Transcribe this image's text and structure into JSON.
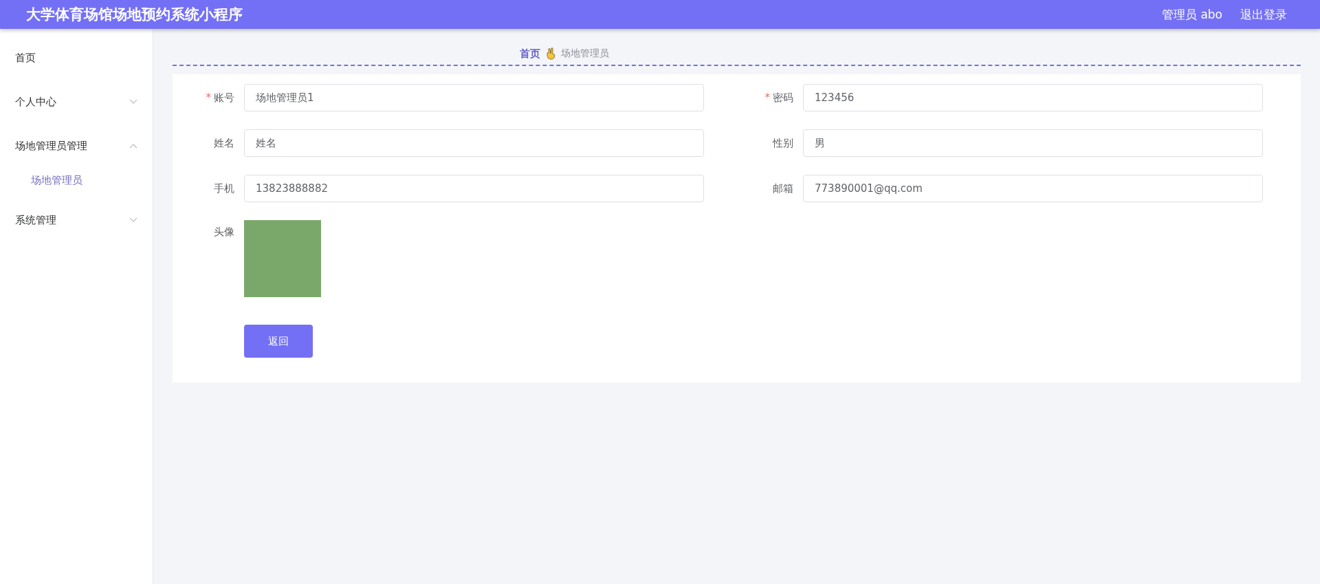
{
  "header": {
    "title": "大学体育场馆场地预约系统小程序",
    "user": "管理员 abo",
    "logout": "退出登录"
  },
  "sidebar": {
    "items": [
      {
        "label": "首页"
      },
      {
        "label": "个人中心",
        "expanded": false
      },
      {
        "label": "场地管理员管理",
        "expanded": true,
        "children": [
          {
            "label": "场地管理员",
            "selected": true
          }
        ]
      },
      {
        "label": "系统管理",
        "expanded": false
      }
    ]
  },
  "breadcrumb": {
    "home": "首页",
    "current": "场地管理员"
  },
  "form": {
    "fields": [
      {
        "label": "账号",
        "required_mark": "*",
        "value": "场地管理员1"
      },
      {
        "label": "密码",
        "required_mark": "*",
        "value": "123456"
      },
      {
        "label": "姓名",
        "placeholder": "姓名"
      },
      {
        "label": "性别",
        "value": "男"
      },
      {
        "label": "手机",
        "value": "13823888882"
      },
      {
        "label": "邮箱",
        "value": "773890001@qq.com"
      }
    ],
    "avatar_label": "头像",
    "back_button": "返回"
  }
}
